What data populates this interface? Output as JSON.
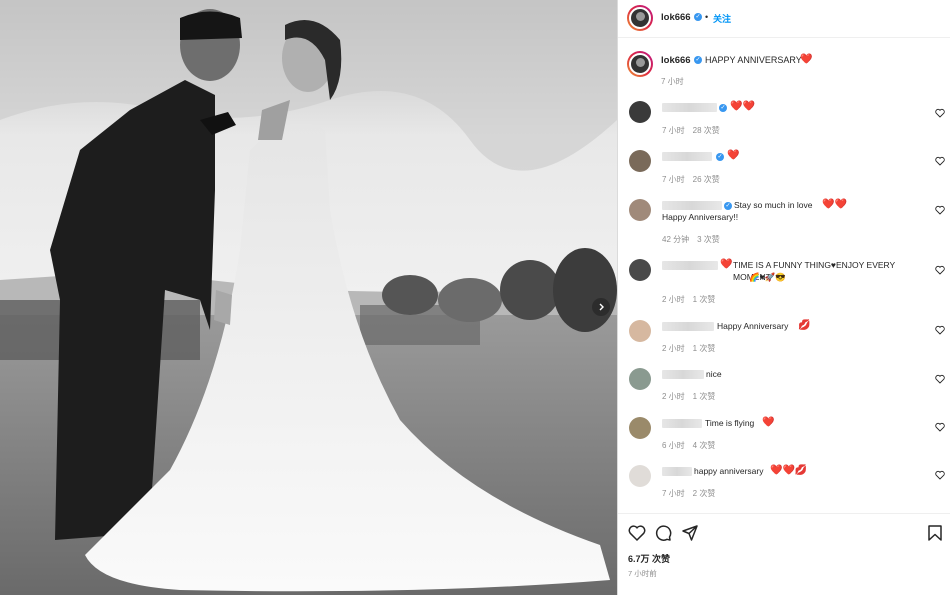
{
  "header": {
    "username": "lok666",
    "dot": "•",
    "follow_label": "关注"
  },
  "caption": {
    "username": "lok666",
    "text": "HAPPY ANNIVERSARY",
    "emoji": "❤️",
    "time": "7 小时"
  },
  "comments": [
    {
      "text": "",
      "emoji": "❤️❤️",
      "time": "7 小时",
      "likes": "28 次赞",
      "verified": true
    },
    {
      "text": "",
      "emoji": "❤️",
      "time": "7 小时",
      "likes": "26 次赞",
      "verified": true
    },
    {
      "text": "Stay so much in love",
      "emoji": "❤️❤️",
      "text2": "Happy Anniversary!!",
      "time": "42 分钟",
      "likes": "3 次赞",
      "verified": true
    },
    {
      "text": "TIME IS A FUNNY THING♥ENJOY EVERY MOMENT",
      "emoji": "❤️",
      "emoji2": "🌈♥🚀😎",
      "time": "2 小时",
      "likes": "1 次赞",
      "verified": false
    },
    {
      "text": "Happy Anniversary",
      "emoji": "💋",
      "time": "2 小时",
      "likes": "1 次赞",
      "verified": false
    },
    {
      "text": "nice",
      "emoji": "",
      "time": "2 小时",
      "likes": "1 次赞",
      "verified": false
    },
    {
      "text": "Time is flying",
      "emoji": "❤️",
      "time": "6 小时",
      "likes": "4 次赞",
      "verified": false
    },
    {
      "text": "happy anniversary",
      "emoji": "❤️❤️💋",
      "time": "7 小时",
      "likes": "2 次赞",
      "verified": false
    }
  ],
  "footer": {
    "likes": "6.7万 次赞",
    "time": "7 小时前"
  },
  "icons": {
    "like": "heart-icon",
    "comment": "comment-icon",
    "share": "paper-plane-icon",
    "save": "bookmark-icon",
    "next": "chevron-right-icon",
    "verified": "verified-badge-icon"
  },
  "colors": {
    "accent": "#0095f6",
    "heart": "#ed2224",
    "verified": "#3897f0",
    "muted": "#8e8e8e"
  }
}
